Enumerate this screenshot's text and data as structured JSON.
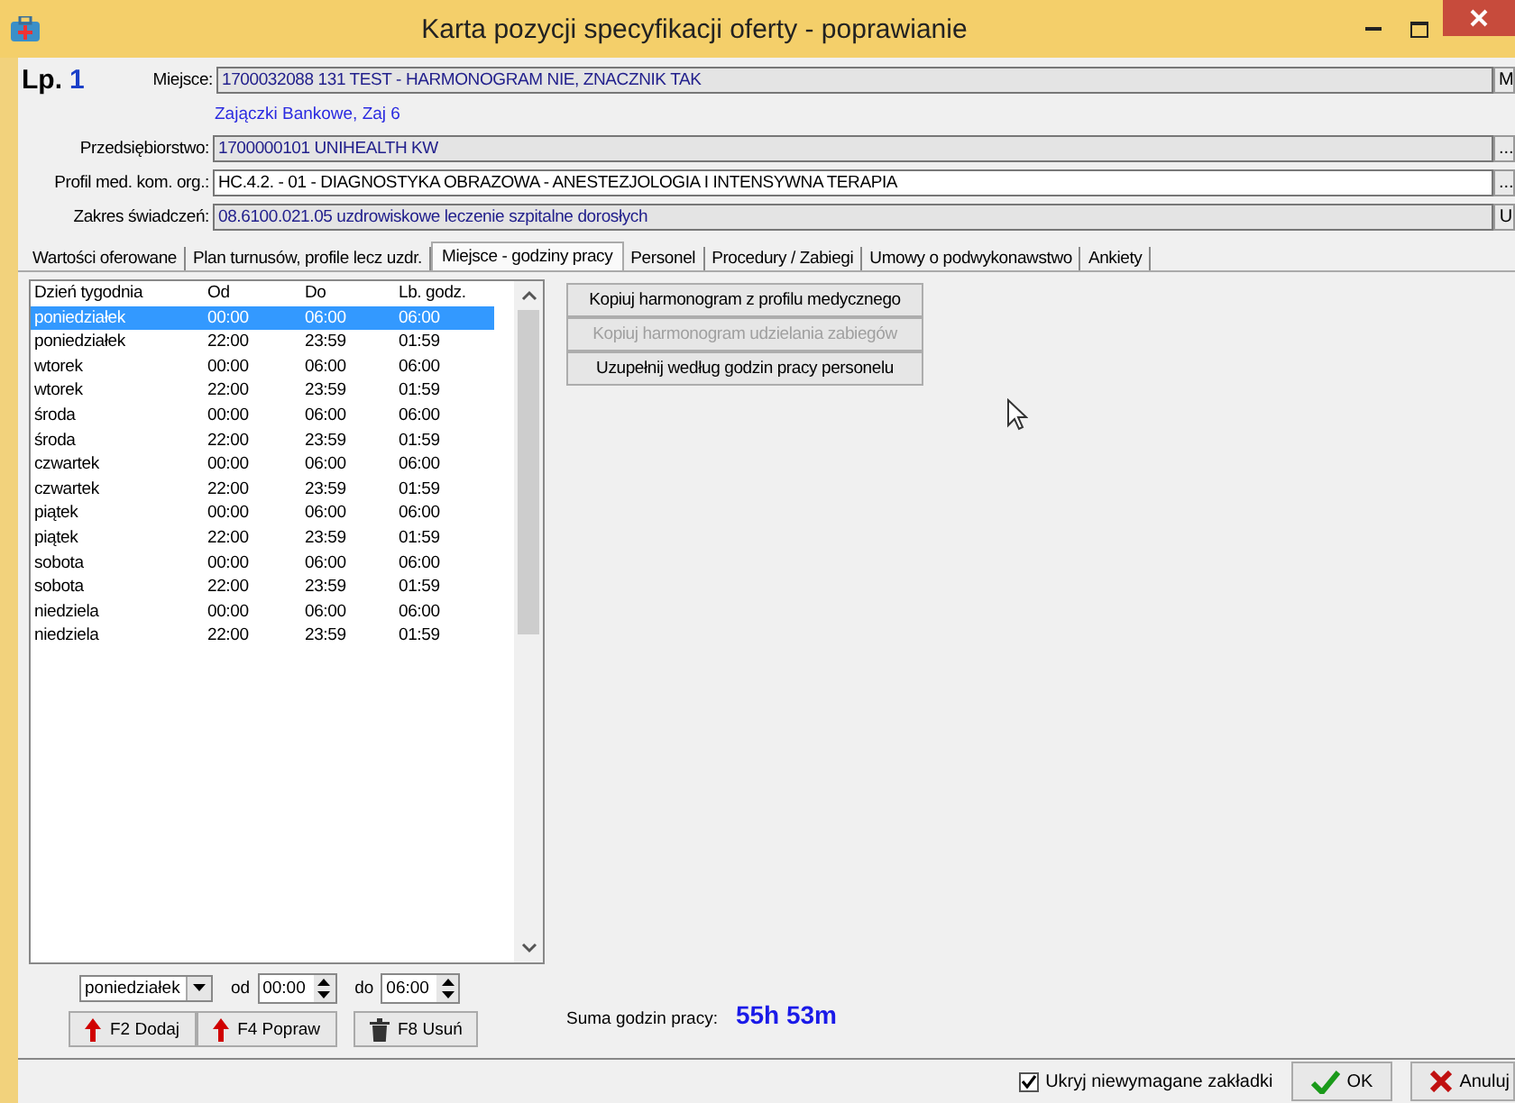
{
  "window": {
    "title": "Karta pozycji specyfikacji oferty - poprawianie"
  },
  "header": {
    "lp_label": "Lp.",
    "lp_value": "1",
    "fields": [
      {
        "label": "Miejsce:",
        "value": "1700032088 131 TEST - HARMONOGRAM NIE, ZNACZNIK TAK",
        "readonly": true,
        "side_button": "M",
        "note": "Zajączki Bankowe, Zaj 6"
      },
      {
        "label": "Przedsiębiorstwo:",
        "value": "1700000101 UNIHEALTH KW",
        "readonly": true,
        "side_button": "..."
      },
      {
        "label": "Profil med. kom. org.:",
        "value": "HC.4.2. - 01 - DIAGNOSTYKA OBRAZOWA - ANESTEZJOLOGIA I INTENSYWNA TERAPIA",
        "readonly": false,
        "side_button": "..."
      },
      {
        "label": "Zakres świadczeń:",
        "value": "08.6100.021.05 uzdrowiskowe leczenie szpitalne dorosłych",
        "readonly": true,
        "side_button": "U"
      }
    ]
  },
  "tabs": [
    {
      "label": "Wartości oferowane",
      "selected": false
    },
    {
      "label": "Plan turnusów, profile lecz uzdr.",
      "selected": false
    },
    {
      "label": "Miejsce - godziny pracy",
      "selected": true
    },
    {
      "label": "Personel",
      "selected": false
    },
    {
      "label": "Procedury / Zabiegi",
      "selected": false
    },
    {
      "label": "Umowy o podwykonawstwo",
      "selected": false
    },
    {
      "label": "Ankiety",
      "selected": false
    }
  ],
  "table": {
    "columns": [
      "Dzień tygodnia",
      "Od",
      "Do",
      "Lb. godz."
    ],
    "rows": [
      {
        "cells": [
          "poniedziałek",
          "00:00",
          "06:00",
          "06:00"
        ],
        "selected": true
      },
      {
        "cells": [
          "poniedziałek",
          "22:00",
          "23:59",
          "01:59"
        ],
        "selected": false
      },
      {
        "cells": [
          "wtorek",
          "00:00",
          "06:00",
          "06:00"
        ],
        "selected": false
      },
      {
        "cells": [
          "wtorek",
          "22:00",
          "23:59",
          "01:59"
        ],
        "selected": false
      },
      {
        "cells": [
          "środa",
          "00:00",
          "06:00",
          "06:00"
        ],
        "selected": false
      },
      {
        "cells": [
          "środa",
          "22:00",
          "23:59",
          "01:59"
        ],
        "selected": false
      },
      {
        "cells": [
          "czwartek",
          "00:00",
          "06:00",
          "06:00"
        ],
        "selected": false
      },
      {
        "cells": [
          "czwartek",
          "22:00",
          "23:59",
          "01:59"
        ],
        "selected": false
      },
      {
        "cells": [
          "piątek",
          "00:00",
          "06:00",
          "06:00"
        ],
        "selected": false
      },
      {
        "cells": [
          "piątek",
          "22:00",
          "23:59",
          "01:59"
        ],
        "selected": false
      },
      {
        "cells": [
          "sobota",
          "00:00",
          "06:00",
          "06:00"
        ],
        "selected": false
      },
      {
        "cells": [
          "sobota",
          "22:00",
          "23:59",
          "01:59"
        ],
        "selected": false
      },
      {
        "cells": [
          "niedziela",
          "00:00",
          "06:00",
          "06:00"
        ],
        "selected": false
      },
      {
        "cells": [
          "niedziela",
          "22:00",
          "23:59",
          "01:59"
        ],
        "selected": false
      }
    ]
  },
  "editor": {
    "day": "poniedziałek",
    "from_label": "od",
    "from": "00:00",
    "to_label": "do",
    "to": "06:00"
  },
  "row_buttons": [
    {
      "kind": "add",
      "label": "F2 Dodaj"
    },
    {
      "kind": "edit",
      "label": "F4 Popraw"
    },
    {
      "kind": "delete",
      "label": "F8 Usuń"
    }
  ],
  "actions": [
    {
      "label": "Kopiuj harmonogram z profilu medycznego",
      "disabled": false
    },
    {
      "label": "Kopiuj harmonogram udzielania zabiegów",
      "disabled": true
    },
    {
      "label": "Uzupełnij według godzin pracy personelu",
      "disabled": false
    }
  ],
  "total": {
    "label": "Suma godzin pracy:",
    "value": "55h 53m"
  },
  "footer": {
    "checkbox": {
      "label": "Ukryj niewymagane zakładki",
      "checked": true
    },
    "ok": "OK",
    "cancel": "Anuluj"
  }
}
